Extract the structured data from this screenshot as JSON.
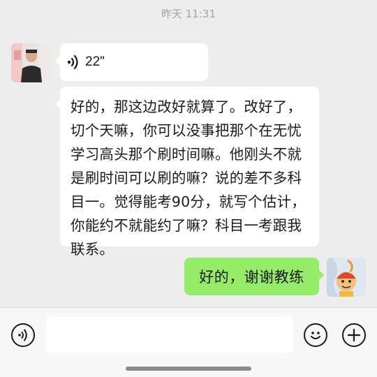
{
  "chat": {
    "timestamp": "昨天 11:31",
    "messages": [
      {
        "type": "voice",
        "sender": "contact",
        "duration": "22\""
      },
      {
        "type": "text",
        "sender": "contact",
        "text": "好的，那这边改好就算了。改好了，切个天嘛，你可以没事把那个在无忧学习高头那个刷时间嘛。他刚头不就是刷时间可以刷的嘛？说的差不多科目一。觉得能考90分，就写个估计，你能约不就能约了嘛？科目一考跟我联系。"
      },
      {
        "type": "text",
        "sender": "self",
        "text": "好的，谢谢教练"
      }
    ]
  },
  "composer": {
    "voice_icon": "voice-input-icon",
    "emoji_icon": "emoji-icon",
    "plus_icon": "plus-icon"
  },
  "colors": {
    "background": "#ededed",
    "received_bubble": "#ffffff",
    "sent_bubble": "#95ec69"
  }
}
